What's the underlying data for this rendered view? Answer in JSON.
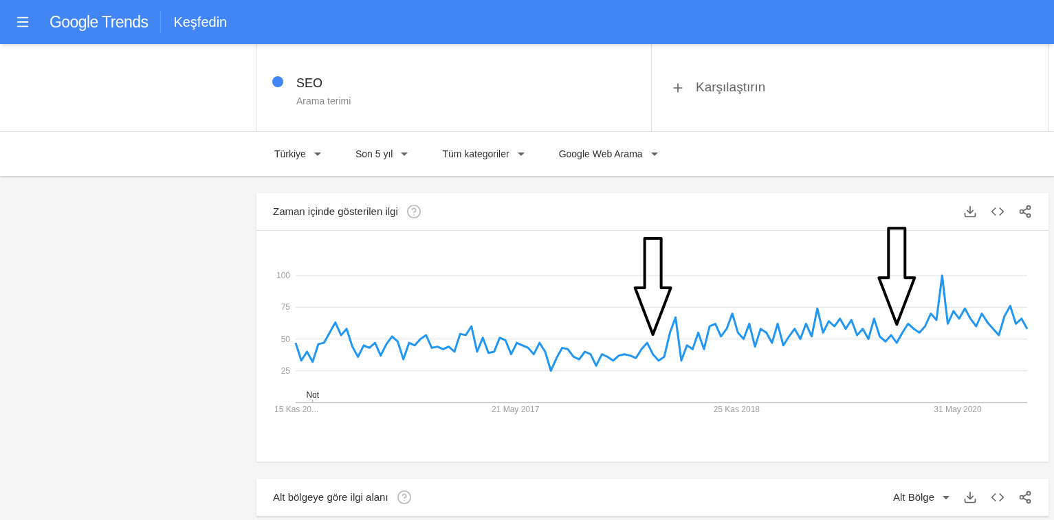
{
  "header": {
    "logo": "Google Trends",
    "title": "Keşfedin"
  },
  "search": {
    "terms": [
      {
        "term": "SEO",
        "subtitle": "Arama terimi",
        "color": "#4285f4"
      }
    ],
    "compare": "Karşılaştırın"
  },
  "filters": [
    "Türkiye",
    "Son 5 yıl",
    "Tüm kategoriler",
    "Google Web Arama"
  ],
  "widgets": [
    {
      "title": "Zaman içinde gösterilen ilgi",
      "chart_data": {
        "type": "line",
        "grid": true,
        "ylim": [
          0,
          100
        ],
        "yticks": [
          25,
          50,
          75,
          100
        ],
        "categories": [
          "15 Kas 20...",
          null,
          null,
          null,
          null,
          null,
          null,
          null,
          null,
          null,
          null,
          null,
          null,
          null,
          null,
          null,
          null,
          null,
          null,
          null,
          null,
          null,
          null,
          null,
          null,
          null,
          null,
          null,
          null,
          null,
          null,
          null,
          null,
          null,
          null,
          null,
          null,
          null,
          null,
          "21 May 2017",
          null,
          null,
          null,
          null,
          null,
          null,
          null,
          null,
          null,
          null,
          null,
          null,
          null,
          null,
          null,
          null,
          null,
          null,
          null,
          null,
          null,
          null,
          null,
          null,
          null,
          null,
          null,
          null,
          null,
          null,
          null,
          null,
          null,
          null,
          null,
          null,
          null,
          null,
          "25 Kas 2018",
          null,
          null,
          null,
          null,
          null,
          null,
          null,
          null,
          null,
          null,
          null,
          null,
          null,
          null,
          null,
          null,
          null,
          null,
          null,
          null,
          null,
          null,
          null,
          null,
          null,
          null,
          null,
          null,
          null,
          null,
          null,
          null,
          null,
          null,
          null,
          null,
          null,
          null,
          "31 May 2020",
          null,
          null,
          null,
          null,
          null,
          null,
          null,
          null,
          null,
          null,
          null,
          null
        ],
        "series": [
          {
            "color": "#2196f3",
            "values": [
              47,
              33,
              40,
              32,
              46,
              47,
              55,
              63,
              53,
              58,
              44,
              36,
              45,
              43,
              47,
              37,
              46,
              52,
              48,
              34,
              47,
              45,
              50,
              53,
              43,
              44,
              42,
              44,
              40,
              54,
              53,
              60,
              40,
              51,
              39,
              40,
              51,
              49,
              38,
              47,
              45,
              43,
              38,
              47,
              40,
              25,
              35,
              43,
              42,
              36,
              34,
              40,
              38,
              29,
              38,
              36,
              33,
              37,
              38,
              37,
              35,
              42,
              47,
              38,
              33,
              36,
              55,
              67,
              33,
              45,
              42,
              55,
              42,
              60,
              62,
              52,
              58,
              70,
              55,
              50,
              62,
              44,
              58,
              55,
              47,
              62,
              45,
              52,
              58,
              50,
              62,
              52,
              74,
              55,
              64,
              60,
              66,
              58,
              65,
              53,
              58,
              50,
              66,
              52,
              48,
              53,
              47,
              55,
              62,
              58,
              55,
              60,
              70,
              65,
              100,
              62,
              72,
              66,
              74,
              66,
              60,
              70,
              63,
              58,
              53,
              68,
              76,
              62,
              66,
              58
            ]
          }
        ],
        "annotations": [
          "Not"
        ]
      }
    },
    {
      "title": "Alt bölgeye göre ilgi alanı",
      "dropdown": "Alt Bölge"
    }
  ]
}
